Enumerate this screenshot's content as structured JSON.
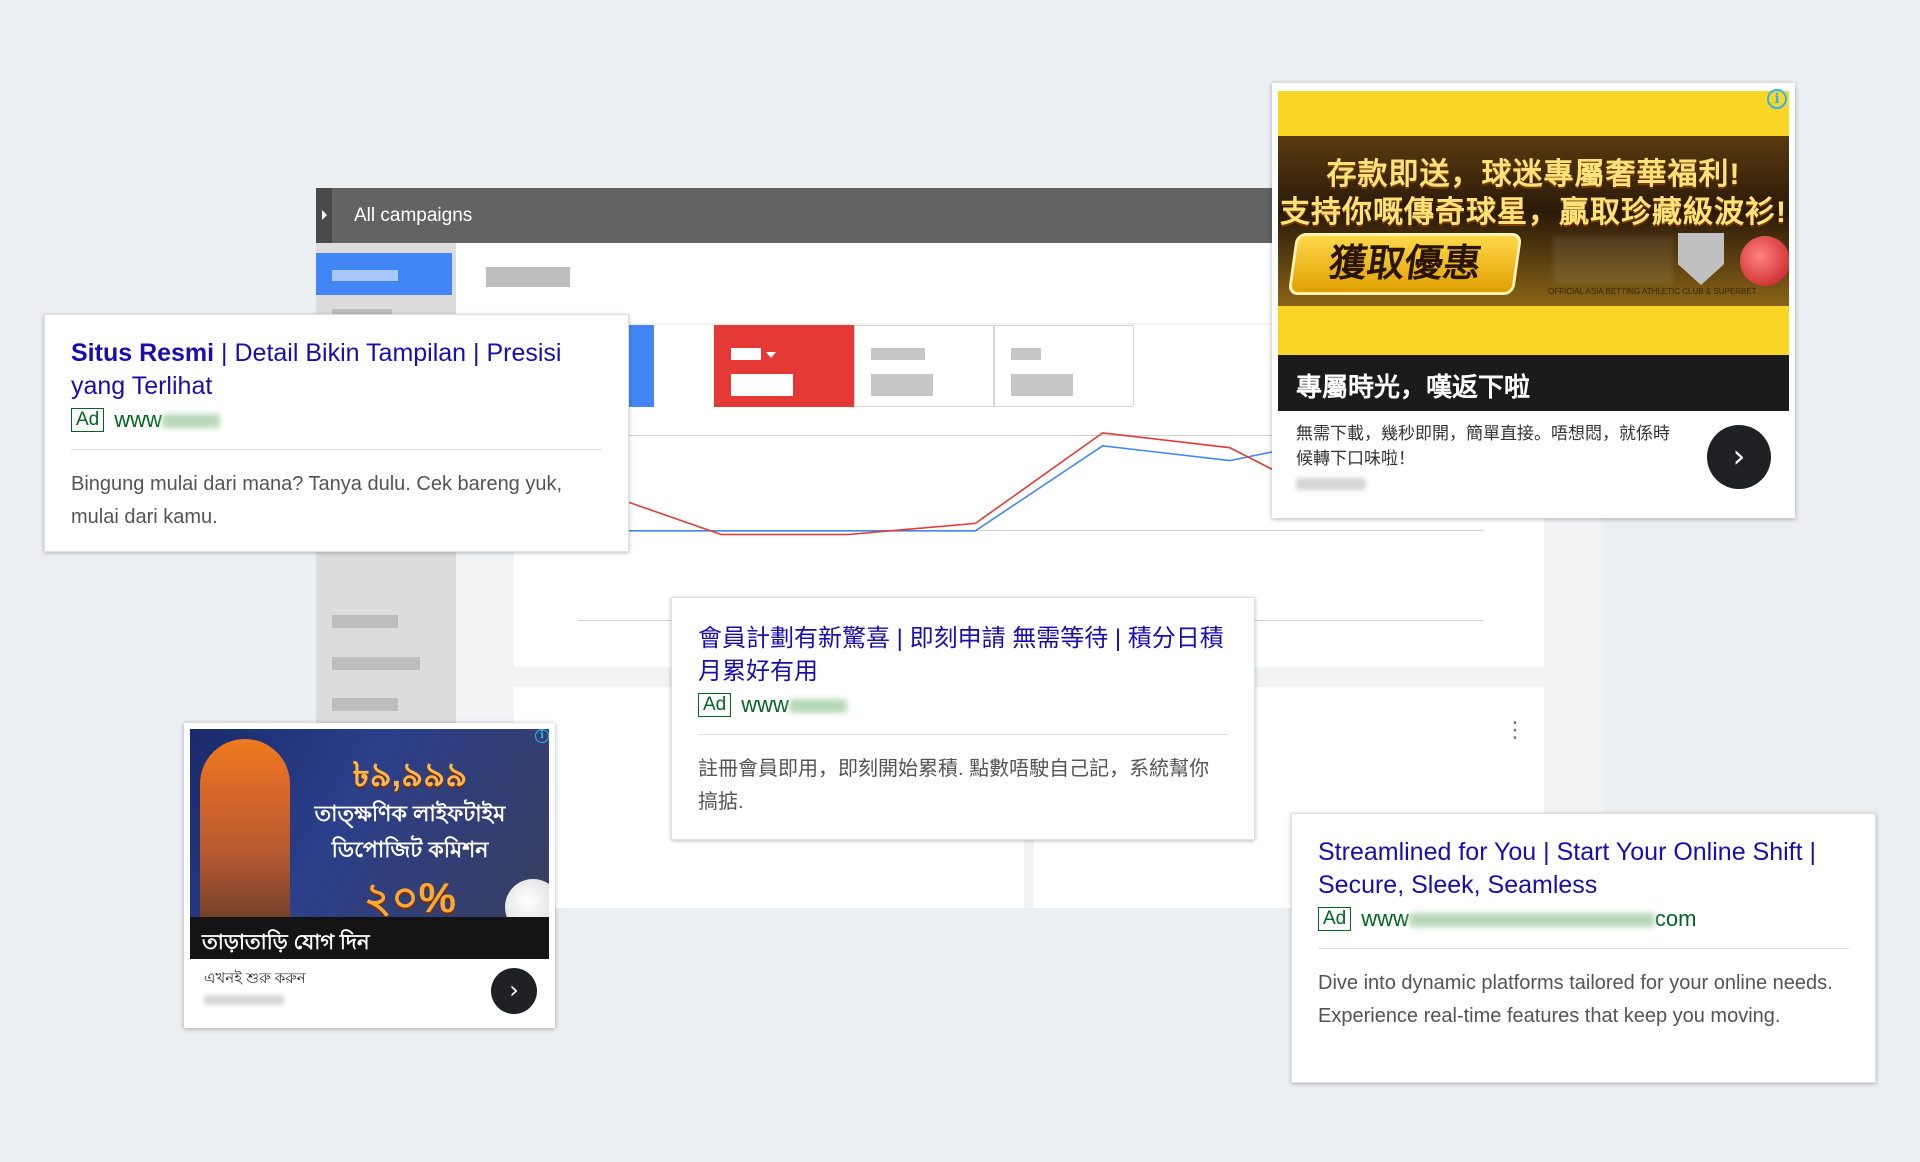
{
  "dashboard": {
    "header_title": "All campaigns"
  },
  "text_ads": [
    {
      "headline_bold": "Situs Resmi",
      "headline_rest": " | Detail Bikin Tampilan | Presisi yang Terlihat",
      "badge": "Ad",
      "url_prefix": "www",
      "url_suffix": "",
      "description": "Bingung mulai dari mana? Tanya dulu. Cek bareng yuk, mulai dari kamu."
    },
    {
      "headline": "會員計劃有新驚喜 | 即刻申請 無需等待 | 積分日積月累好有用",
      "badge": "Ad",
      "url_prefix": "www",
      "url_suffix": "",
      "description": "註冊會員即用，即刻開始累積. 點數唔駛自己記，系統幫你搞掂."
    },
    {
      "headline": "Streamlined for You | Start Your Online Shift | Secure, Sleek, Seamless",
      "badge": "Ad",
      "url_prefix": "www",
      "url_suffix": "com",
      "description": "Dive into dynamic platforms tailored for your online needs. Experience real-time features that keep you moving."
    }
  ],
  "display_ads": [
    {
      "info_icon": "info-icon",
      "banner_line1": "存款即送，球迷專屬奢華福利!",
      "banner_line2": "支持你嘅傳奇球星，贏取珍藏級波衫!",
      "banner_cta": "獲取優惠",
      "banner_smallprint": "OFFICIAL ASIA BETTING ATHLETIC CLUB & SUPERBET",
      "caption": "專屬時光，嘆返下啦",
      "body": "無需下載，幾秒即開，簡單直接。唔想悶，就係時候轉下口味啦！",
      "go_icon": "chevron-right-icon"
    },
    {
      "info_icon": "info-icon",
      "banner_amount": "৳৯,৯৯৯",
      "banner_line1": "তাত্ক্ষণিক লাইফটাইম",
      "banner_line2": "ডিপোজিট কমিশন",
      "banner_percent": "২০%",
      "caption": "তাড়াতাড়ি যোগ দিন",
      "body": "এখনই শুরু করুন",
      "go_icon": "chevron-right-icon"
    }
  ],
  "colors": {
    "headline_link": "#1a0dab",
    "url_green": "#006621",
    "series_blue": "#4285f4",
    "series_red": "#e53935",
    "ad_yellow": "#fcd627"
  },
  "chart_data": {
    "type": "line",
    "series": [
      {
        "values": [
          100,
          100,
          100,
          100,
          54,
          62,
          48,
          46
        ]
      },
      {
        "values": [
          78,
          102,
          102,
          96,
          47,
          55,
          90,
          84
        ]
      }
    ],
    "title": "",
    "xlabel": "",
    "ylabel": "",
    "grid": true,
    "note": "lower value = higher on screen; series unlabeled in image"
  }
}
